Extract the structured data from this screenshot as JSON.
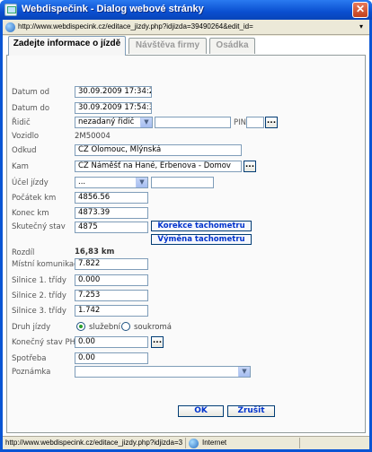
{
  "window": {
    "title": "Webdispečink - Dialog webové stránky"
  },
  "address_bar": {
    "url": "http://www.webdispecink.cz/editace_jizdy.php?idjizda=39490264&edit_id="
  },
  "tabs": [
    {
      "label": "Zadejte informace o jízdě",
      "active": true
    },
    {
      "label": "Návštěva firmy",
      "active": false
    },
    {
      "label": "Osádka",
      "active": false
    }
  ],
  "form": {
    "datum_od": {
      "label": "Datum od",
      "value": "30.09.2009 17:34:20"
    },
    "datum_do": {
      "label": "Datum do",
      "value": "30.09.2009 17:54:38"
    },
    "ridic": {
      "label": "Řidič",
      "selected": "nezadaný řidič",
      "text": "",
      "pin_label": "PIN",
      "pin_value": "",
      "lookup_label": "..."
    },
    "vozidlo": {
      "label": "Vozidlo",
      "value": "2M50004"
    },
    "odkud": {
      "label": "Odkud",
      "value": "CZ Olomouc, Mlýnská"
    },
    "kam": {
      "label": "Kam",
      "value": "CZ Náměšť na Hané, Erbenova - Domov",
      "lookup_label": "..."
    },
    "ucel_jizdy": {
      "label": "Účel jízdy",
      "selected": "...",
      "text": ""
    },
    "pocatek_km": {
      "label": "Počátek km",
      "value": "4856.56"
    },
    "konec_km": {
      "label": "Konec km",
      "value": "4873.39"
    },
    "skutecny_stav": {
      "label": "Skutečný stav",
      "value": "4875"
    },
    "korekce_button": "Korekce tachometru",
    "vymena_button": "Výměna tachometru",
    "rozdil": {
      "label": "Rozdíl",
      "value": "16,83 km"
    },
    "mistni_komunikace": {
      "label": "Místní komunikace",
      "value": "7.822"
    },
    "silnice_1": {
      "label": "Silnice 1. třídy",
      "value": "0.000"
    },
    "silnice_2": {
      "label": "Silnice 2. třídy",
      "value": "7.253"
    },
    "silnice_3": {
      "label": "Silnice 3. třídy",
      "value": "1.742"
    },
    "druh_jizdy": {
      "label": "Druh jízdy",
      "option_1": "služební",
      "option_2": "soukromá",
      "selected": "služební"
    },
    "konecny_stav_phm": {
      "label": "Konečný stav PHM",
      "value": "0.00",
      "lookup_label": "..."
    },
    "spotreba": {
      "label": "Spotřeba",
      "value": "0.00"
    },
    "poznamka": {
      "label": "Poznámka",
      "selected": ""
    }
  },
  "buttons": {
    "ok": "OK",
    "cancel": "Zrušit"
  },
  "status_bar": {
    "url": "http://www.webdispecink.cz/editace_jizdy.php?idjizda=3",
    "zone": "Internet"
  }
}
